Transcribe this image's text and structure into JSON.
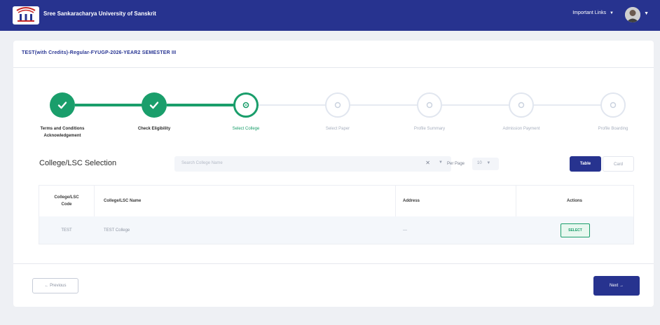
{
  "header": {
    "logo_icon": "university-logo-icon",
    "app_title": "Sree Sankaracharya University of Sanskrit",
    "links_label": "Important Links",
    "links_chevron_icon": "chevron-down-icon",
    "avatar_icon": "user-avatar-icon",
    "avatar_chevron_icon": "chevron-down-icon",
    "brand_color": "#27338f"
  },
  "page": {
    "exam_title": "TEST(with Credits)-Regular-FYUGP-2026-YEAR2 SEMESTER III"
  },
  "stepper": {
    "active_color": "#1a9e6b",
    "steps": [
      {
        "label_line1": "Terms and Conditions",
        "label_line2": "Acknowledgement",
        "state": "done",
        "icon": "check-icon"
      },
      {
        "label_line1": "Check Eligibility",
        "label_line2": "",
        "state": "done",
        "icon": "check-icon"
      },
      {
        "label_line1": "Select College",
        "label_line2": "",
        "state": "active",
        "icon": "gear-icon"
      },
      {
        "label_line1": "Select Paper",
        "label_line2": "",
        "state": "pending",
        "icon": "gear-icon"
      },
      {
        "label_line1": "Profile Summary",
        "label_line2": "",
        "state": "pending",
        "icon": "gear-icon"
      },
      {
        "label_line1": "Admission Payment",
        "label_line2": "",
        "state": "pending",
        "icon": "gear-icon"
      },
      {
        "label_line1": "Profile Boarding",
        "label_line2": "",
        "state": "pending",
        "icon": "gear-icon"
      }
    ]
  },
  "selection": {
    "title": "College/LSC Selection",
    "search_placeholder": "Search College Name",
    "clear_symbol": "✕",
    "per_page_label": "Per Page",
    "per_page_value": "10",
    "view_table_label": "Table",
    "view_card_label": "Card"
  },
  "table": {
    "columns": [
      "College/LSC Code",
      "College/LSC Name",
      "Address",
      "Actions"
    ],
    "rows": [
      {
        "code": "TEST",
        "name": "TEST College",
        "address": "---",
        "action": "SELECT"
      }
    ]
  },
  "footer": {
    "previous_label": "← Previous",
    "next_label": "Next →"
  }
}
